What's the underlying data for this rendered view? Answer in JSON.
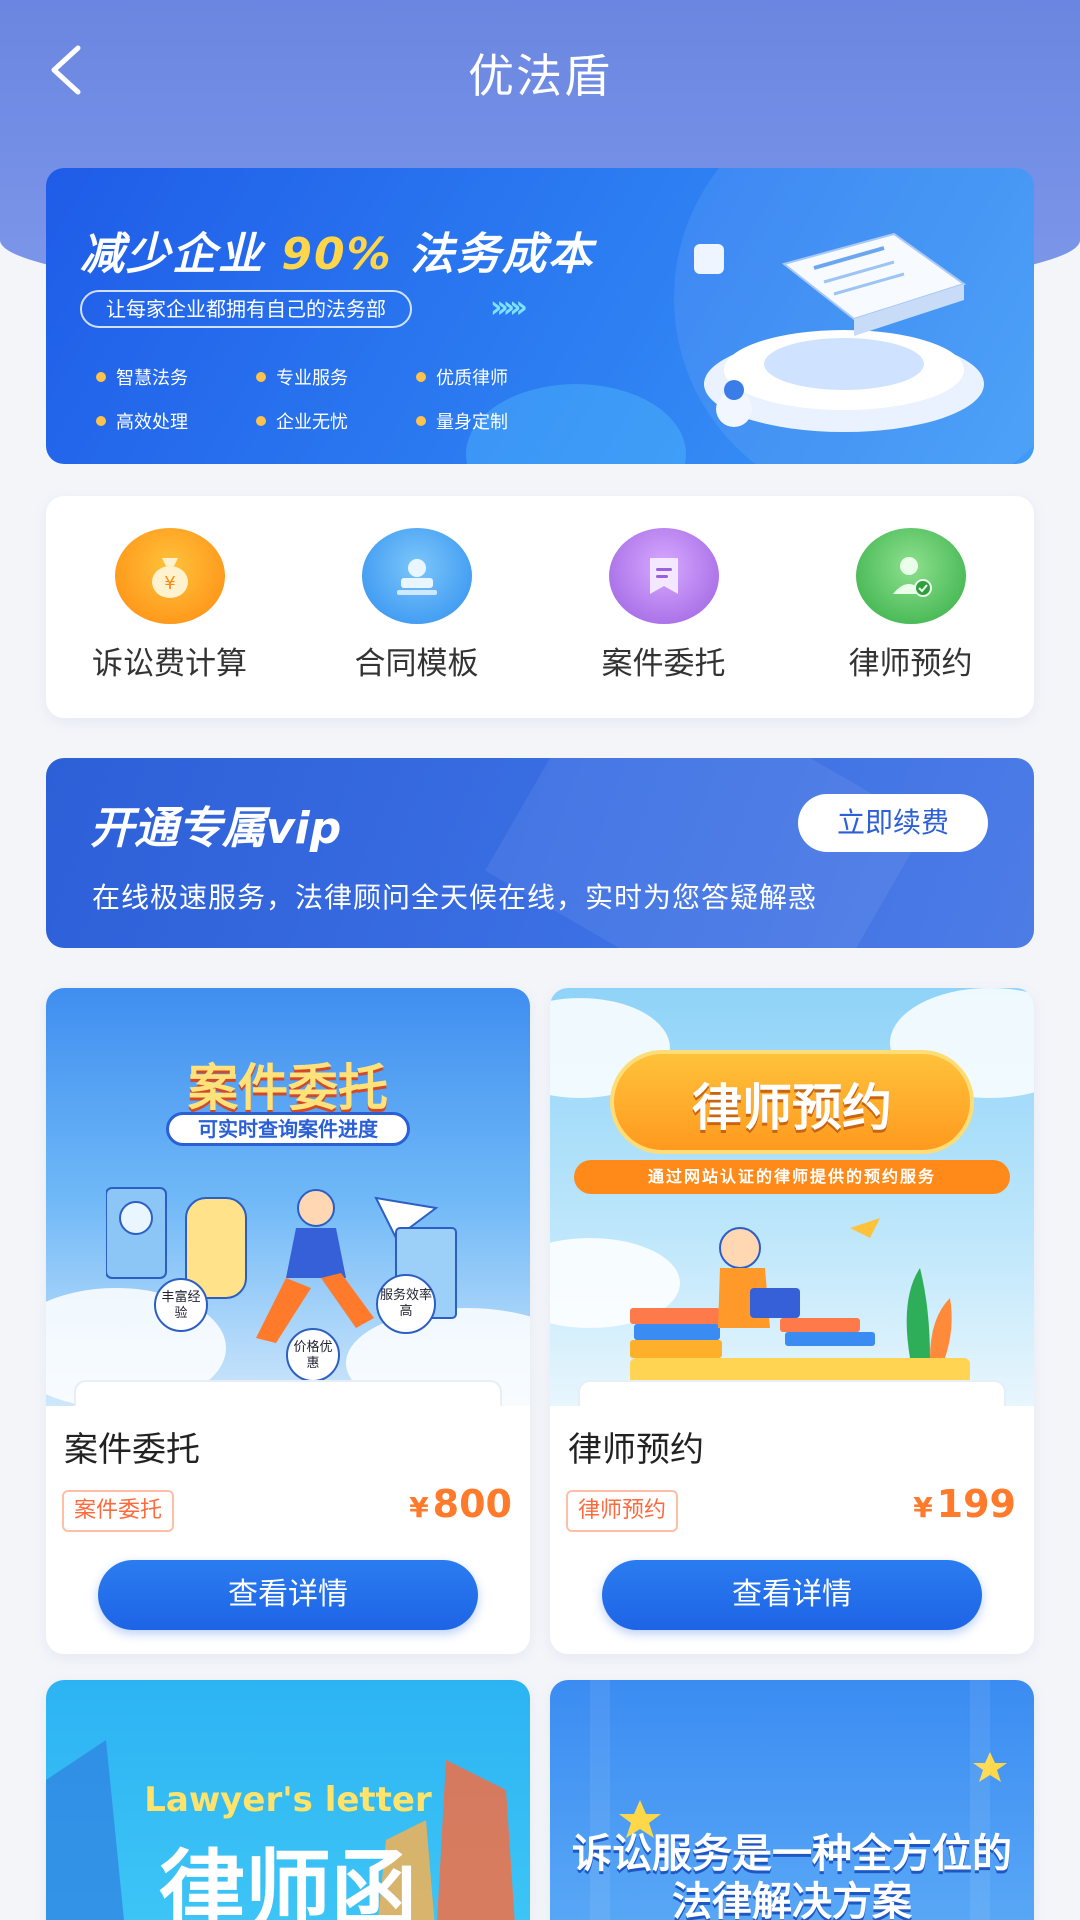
{
  "nav": {
    "title": "优法盾",
    "back_icon": "chevron-left-icon"
  },
  "banner": {
    "headline_pre": "减少企业",
    "headline_highlight": "90%",
    "headline_post": "法务成本",
    "slogan": "让每家企业都拥有自己的法务部",
    "arrows": "›››››",
    "features": [
      "智慧法务",
      "专业服务",
      "优质律师",
      "高效处理",
      "企业无忧",
      "量身定制"
    ]
  },
  "services": [
    {
      "label": "诉讼费计算",
      "icon": "money-bag-icon",
      "color": "#ff9a1f"
    },
    {
      "label": "合同模板",
      "icon": "stamp-icon",
      "color": "#4aa8f2"
    },
    {
      "label": "案件委托",
      "icon": "document-icon",
      "color": "#b07ae6"
    },
    {
      "label": "律师预约",
      "icon": "lawyer-icon",
      "color": "#4ec25a"
    }
  ],
  "vip": {
    "title": "开通专属vip",
    "button": "立即续费",
    "subtitle": "在线极速服务，法律顾问全天候在线，实时为您答疑解惑"
  },
  "products": [
    {
      "image_title": "案件委托",
      "image_subtitle": "可实时查询案件进度",
      "image_tags": [
        "丰富经验",
        "服务效率高",
        "价格优惠"
      ],
      "name": "案件委托",
      "tag": "案件委托",
      "currency": "¥",
      "price": "800",
      "button": "查看详情"
    },
    {
      "image_title": "律师预约",
      "image_subtitle": "通过网站认证的律师提供的预约服务",
      "name": "律师预约",
      "tag": "律师预约",
      "currency": "¥",
      "price": "199",
      "button": "查看详情"
    },
    {
      "image_title_en": "Lawyer's letter",
      "image_title": "律师函"
    },
    {
      "image_title": "诉讼服务是一种全方位的法律解决方案"
    }
  ]
}
